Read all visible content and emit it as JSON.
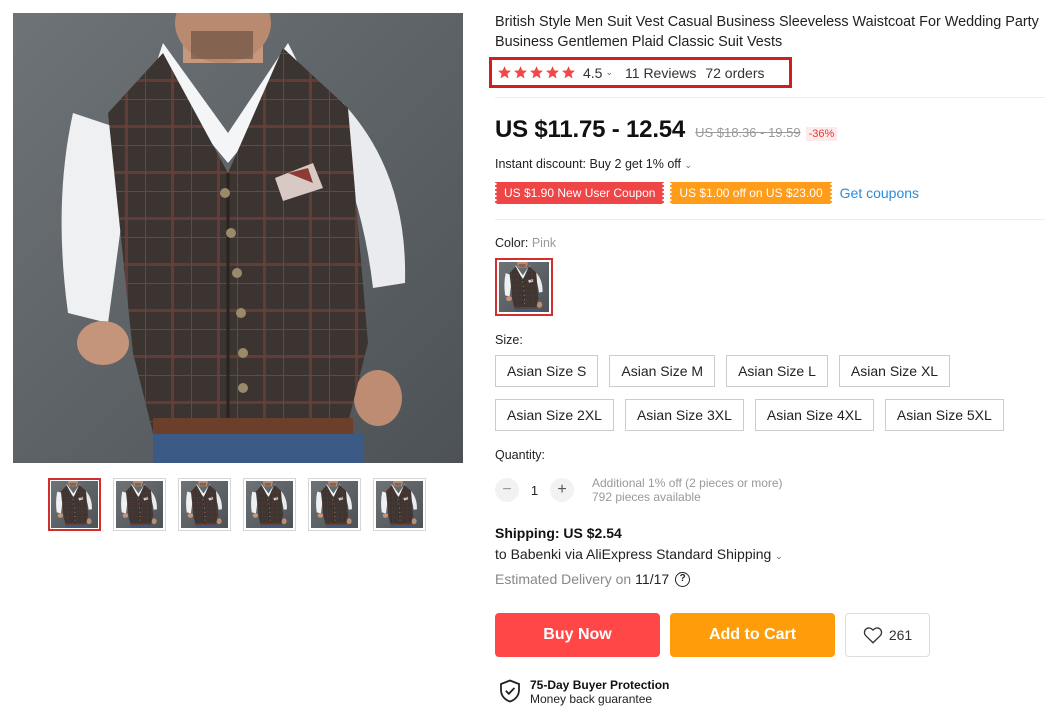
{
  "product": {
    "title": "British Style Men Suit Vest Casual Business Sleeveless Waistcoat For Wedding Party Business Gentlemen Plaid Classic Suit Vests",
    "image_alt": "man wearing plaid suit vest"
  },
  "rating": {
    "value": "4.5",
    "stars": 5,
    "reviews": "11 Reviews",
    "orders": "72 orders",
    "star_color": "#f0484b",
    "highlight_color": "#d01f1f"
  },
  "price": {
    "current": "US $11.75 - 12.54",
    "original": "US $18.36 - 19.59",
    "discount": "-36%"
  },
  "instant_discount": "Instant discount: Buy 2 get 1% off",
  "coupons": {
    "items": [
      "US $1.90 New User Coupon",
      "US $1.00 off on US $23.00"
    ],
    "get_label": "Get coupons"
  },
  "color": {
    "label": "Color:",
    "selected": "Pink"
  },
  "size": {
    "label": "Size:",
    "row1": [
      "Asian Size S",
      "Asian Size M",
      "Asian Size L",
      "Asian Size XL"
    ],
    "row2": [
      "Asian Size 2XL",
      "Asian Size 3XL",
      "Asian Size 4XL",
      "Asian Size 5XL"
    ]
  },
  "quantity": {
    "label": "Quantity:",
    "minus": "−",
    "plus": "+",
    "value": "1",
    "note1": "Additional 1% off (2 pieces or more)",
    "note2": "792 pieces available"
  },
  "shipping": {
    "title": "Shipping: US $2.54",
    "to": "to Babenki via AliExpress Standard Shipping",
    "estimated_prefix": "Estimated Delivery on",
    "estimated_date": "11/17",
    "help": "?"
  },
  "actions": {
    "buy_now": "Buy Now",
    "add_to_cart": "Add to Cart",
    "wishlist_count": "261"
  },
  "protection": {
    "title": "75-Day Buyer Protection",
    "subtitle": "Money back guarantee"
  },
  "thumbnails": 6
}
